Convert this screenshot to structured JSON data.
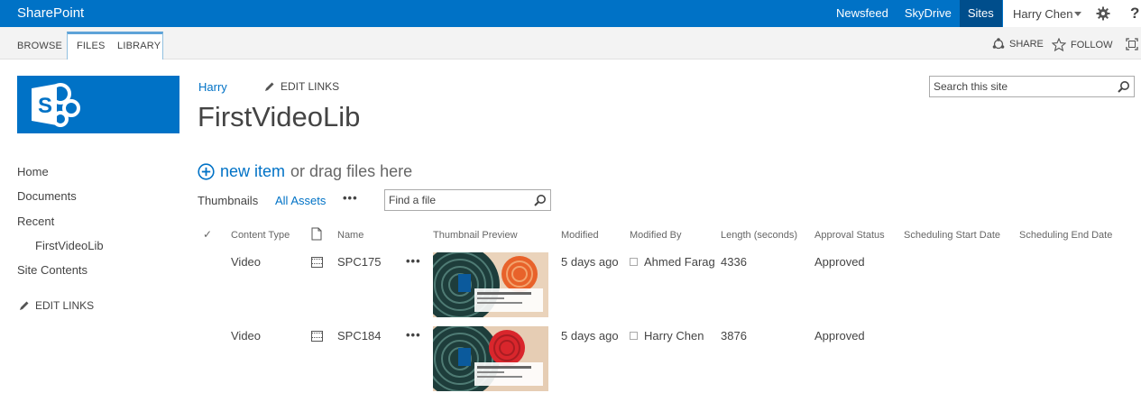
{
  "suitebar": {
    "brand": "SharePoint",
    "links": [
      "Newsfeed",
      "SkyDrive",
      "Sites"
    ],
    "user": "Harry Chen",
    "help": "?"
  },
  "ribbon": {
    "tabs": [
      "BROWSE",
      "FILES",
      "LIBRARY"
    ],
    "share": "SHARE",
    "follow": "FOLLOW"
  },
  "header": {
    "breadcrumb": "Harry",
    "edit_links": "EDIT LINKS",
    "title": "FirstVideoLib",
    "search_placeholder": "Search this site"
  },
  "leftnav": {
    "items": [
      "Home",
      "Documents",
      "Recent",
      "FirstVideoLib",
      "Site Contents"
    ],
    "edit_links": "EDIT LINKS"
  },
  "library": {
    "new_item": "new item",
    "drag_text": "or drag files here",
    "views": [
      "Thumbnails",
      "All Assets"
    ],
    "more": "•••",
    "find_placeholder": "Find a file",
    "columns": [
      "Content Type",
      "Name",
      "Thumbnail Preview",
      "Modified",
      "Modified By",
      "Length (seconds)",
      "Approval Status",
      "Scheduling Start Date",
      "Scheduling End Date"
    ],
    "rows": [
      {
        "content_type": "Video",
        "name": "SPC175",
        "modified": "5 days ago",
        "modified_by": "Ahmed Farag",
        "length": "4336",
        "approval": "Approved",
        "accent": "#e8622a"
      },
      {
        "content_type": "Video",
        "name": "SPC184",
        "modified": "5 days ago",
        "modified_by": "Harry Chen",
        "length": "3876",
        "approval": "Approved",
        "accent": "#d9262c"
      }
    ],
    "row_more": "•••"
  },
  "colors": {
    "brand_blue": "#0072c6",
    "active_link_bg": "#004e8c"
  }
}
